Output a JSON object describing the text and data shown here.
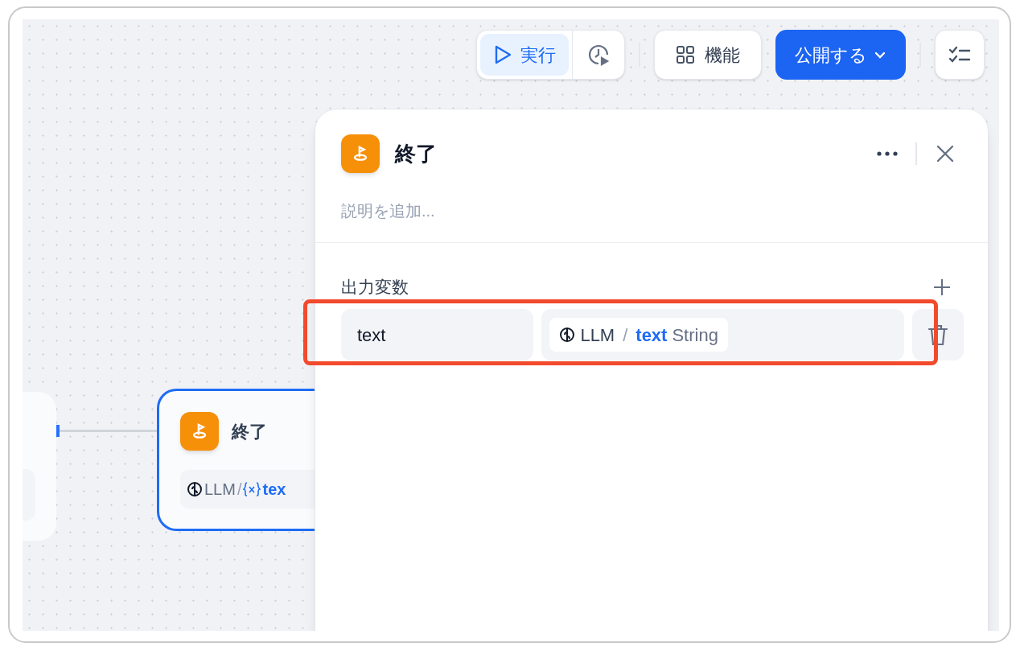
{
  "toolbar": {
    "run": {
      "label": "実行",
      "selected": true
    },
    "features": {
      "label": "機能"
    },
    "publish": {
      "label": "公開する"
    }
  },
  "canvas": {
    "end_node": {
      "title": "終了",
      "selected": true,
      "source": "LLM",
      "separator": "/",
      "variable": "tex"
    }
  },
  "panel": {
    "title": "終了",
    "description_placeholder": "説明を追加...",
    "section_title": "出力変数",
    "highlighted": true,
    "outputs": [
      {
        "name": "text",
        "source": "LLM",
        "separator": "/",
        "variable": "text",
        "type": "String"
      }
    ]
  }
}
